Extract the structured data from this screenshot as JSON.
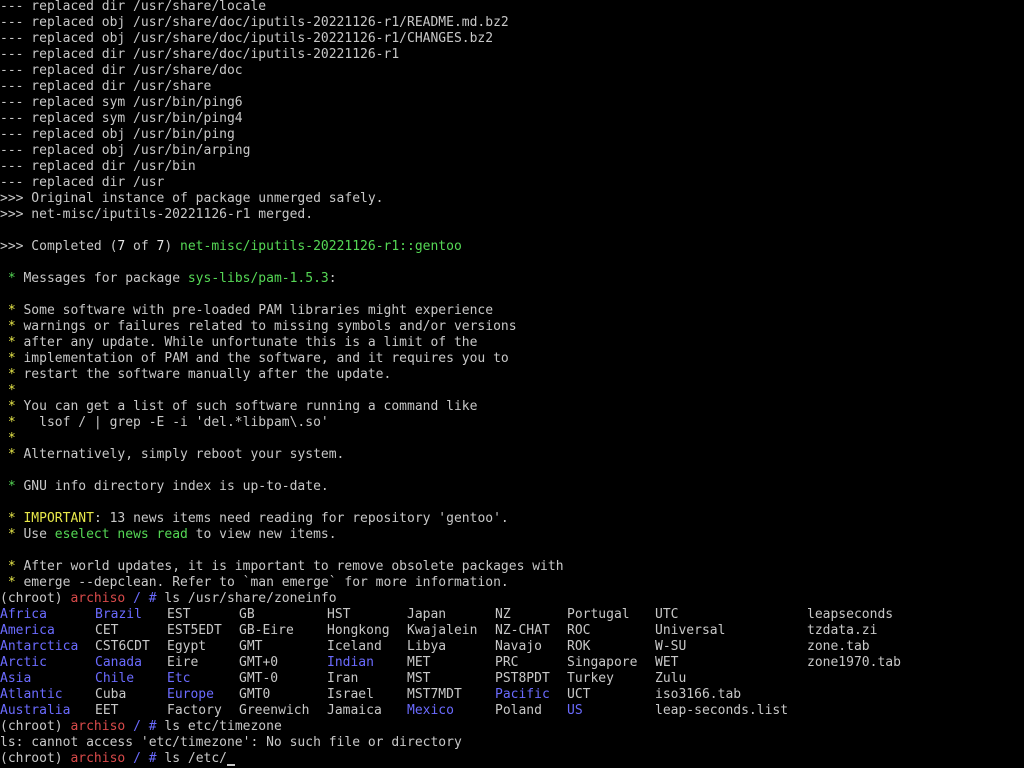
{
  "theme": {
    "background": "#000000",
    "default": "#c8c8c8",
    "green": "#55d855",
    "yellow": "#e8e84a",
    "blue": "#6b6bff",
    "red": "#d84a4a"
  },
  "lines_before": [
    [
      {
        "t": "--- replaced dir /usr/share/locale",
        "c": "default"
      }
    ],
    [
      {
        "t": "--- replaced obj /usr/share/doc/iputils-20221126-r1/README.md.bz2",
        "c": "default"
      }
    ],
    [
      {
        "t": "--- replaced obj /usr/share/doc/iputils-20221126-r1/CHANGES.bz2",
        "c": "default"
      }
    ],
    [
      {
        "t": "--- replaced dir /usr/share/doc/iputils-20221126-r1",
        "c": "default"
      }
    ],
    [
      {
        "t": "--- replaced dir /usr/share/doc",
        "c": "default"
      }
    ],
    [
      {
        "t": "--- replaced dir /usr/share",
        "c": "default"
      }
    ],
    [
      {
        "t": "--- replaced sym /usr/bin/ping6",
        "c": "default"
      }
    ],
    [
      {
        "t": "--- replaced sym /usr/bin/ping4",
        "c": "default"
      }
    ],
    [
      {
        "t": "--- replaced obj /usr/bin/ping",
        "c": "default"
      }
    ],
    [
      {
        "t": "--- replaced obj /usr/bin/arping",
        "c": "default"
      }
    ],
    [
      {
        "t": "--- replaced dir /usr/bin",
        "c": "default"
      }
    ],
    [
      {
        "t": "--- replaced dir /usr",
        "c": "default"
      }
    ],
    [
      {
        "t": ">>> Original instance of package unmerged safely.",
        "c": "default"
      }
    ],
    [
      {
        "t": ">>> net-misc/iputils-20221126-r1 merged.",
        "c": "default"
      }
    ],
    [],
    [
      {
        "t": ">>> Completed (",
        "c": "default"
      },
      {
        "t": "7",
        "c": "bold"
      },
      {
        "t": " of ",
        "c": "default"
      },
      {
        "t": "7",
        "c": "bold"
      },
      {
        "t": ") ",
        "c": "default"
      },
      {
        "t": "net-misc/iputils-20221126-r1::gentoo",
        "c": "green"
      }
    ],
    [],
    [
      {
        "t": " * ",
        "c": "green"
      },
      {
        "t": "Messages for package ",
        "c": "default"
      },
      {
        "t": "sys-libs/pam-1.5.3",
        "c": "green"
      },
      {
        "t": ":",
        "c": "default"
      }
    ],
    [],
    [
      {
        "t": " * ",
        "c": "yellow"
      },
      {
        "t": "Some software with pre-loaded PAM libraries might experience",
        "c": "default"
      }
    ],
    [
      {
        "t": " * ",
        "c": "yellow"
      },
      {
        "t": "warnings or failures related to missing symbols and/or versions",
        "c": "default"
      }
    ],
    [
      {
        "t": " * ",
        "c": "yellow"
      },
      {
        "t": "after any update. While unfortunate this is a limit of the",
        "c": "default"
      }
    ],
    [
      {
        "t": " * ",
        "c": "yellow"
      },
      {
        "t": "implementation of PAM and the software, and it requires you to",
        "c": "default"
      }
    ],
    [
      {
        "t": " * ",
        "c": "yellow"
      },
      {
        "t": "restart the software manually after the update.",
        "c": "default"
      }
    ],
    [
      {
        "t": " * ",
        "c": "yellow"
      }
    ],
    [
      {
        "t": " * ",
        "c": "yellow"
      },
      {
        "t": "You can get a list of such software running a command like",
        "c": "default"
      }
    ],
    [
      {
        "t": " * ",
        "c": "yellow"
      },
      {
        "t": "  lsof / | grep -E -i 'del.*libpam\\.so'",
        "c": "default"
      }
    ],
    [
      {
        "t": " * ",
        "c": "yellow"
      }
    ],
    [
      {
        "t": " * ",
        "c": "yellow"
      },
      {
        "t": "Alternatively, simply reboot your system.",
        "c": "default"
      }
    ],
    [],
    [
      {
        "t": " * ",
        "c": "green"
      },
      {
        "t": "GNU info directory index is up-to-date.",
        "c": "default"
      }
    ],
    [],
    [
      {
        "t": " * ",
        "c": "yellow"
      },
      {
        "t": "IMPORTANT",
        "c": "yellow"
      },
      {
        "t": ": 13 news items need reading for repository 'gentoo'.",
        "c": "default"
      }
    ],
    [
      {
        "t": " * ",
        "c": "yellow"
      },
      {
        "t": "Use ",
        "c": "default"
      },
      {
        "t": "eselect news read",
        "c": "green"
      },
      {
        "t": " to view new items.",
        "c": "default"
      }
    ],
    [],
    [
      {
        "t": " * ",
        "c": "yellow"
      },
      {
        "t": "After world updates, it is important to remove obsolete packages with",
        "c": "default"
      }
    ],
    [
      {
        "t": " * ",
        "c": "yellow"
      },
      {
        "t": "emerge --depclean. Refer to `man emerge` for more information.",
        "c": "default"
      }
    ],
    [
      {
        "t": "(chroot) ",
        "c": "default"
      },
      {
        "t": "archiso",
        "c": "red"
      },
      {
        "t": " / # ",
        "c": "blue"
      },
      {
        "t": "ls /usr/share/zoneinfo",
        "c": "default"
      }
    ]
  ],
  "zoneinfo_columns": [
    [
      {
        "t": "Africa",
        "c": "blue"
      },
      {
        "t": "America",
        "c": "blue"
      },
      {
        "t": "Antarctica",
        "c": "blue"
      },
      {
        "t": "Arctic",
        "c": "blue"
      },
      {
        "t": "Asia",
        "c": "blue"
      },
      {
        "t": "Atlantic",
        "c": "blue"
      },
      {
        "t": "Australia",
        "c": "blue"
      }
    ],
    [
      {
        "t": "Brazil",
        "c": "blue"
      },
      {
        "t": "CET",
        "c": "default"
      },
      {
        "t": "CST6CDT",
        "c": "default"
      },
      {
        "t": "Canada",
        "c": "blue"
      },
      {
        "t": "Chile",
        "c": "blue"
      },
      {
        "t": "Cuba",
        "c": "default"
      },
      {
        "t": "EET",
        "c": "default"
      }
    ],
    [
      {
        "t": "EST",
        "c": "default"
      },
      {
        "t": "EST5EDT",
        "c": "default"
      },
      {
        "t": "Egypt",
        "c": "default"
      },
      {
        "t": "Eire",
        "c": "default"
      },
      {
        "t": "Etc",
        "c": "blue"
      },
      {
        "t": "Europe",
        "c": "blue"
      },
      {
        "t": "Factory",
        "c": "default"
      }
    ],
    [
      {
        "t": "GB",
        "c": "default"
      },
      {
        "t": "GB-Eire",
        "c": "default"
      },
      {
        "t": "GMT",
        "c": "default"
      },
      {
        "t": "GMT+0",
        "c": "default"
      },
      {
        "t": "GMT-0",
        "c": "default"
      },
      {
        "t": "GMT0",
        "c": "default"
      },
      {
        "t": "Greenwich",
        "c": "default"
      }
    ],
    [
      {
        "t": "HST",
        "c": "default"
      },
      {
        "t": "Hongkong",
        "c": "default"
      },
      {
        "t": "Iceland",
        "c": "default"
      },
      {
        "t": "Indian",
        "c": "blue"
      },
      {
        "t": "Iran",
        "c": "default"
      },
      {
        "t": "Israel",
        "c": "default"
      },
      {
        "t": "Jamaica",
        "c": "default"
      }
    ],
    [
      {
        "t": "Japan",
        "c": "default"
      },
      {
        "t": "Kwajalein",
        "c": "default"
      },
      {
        "t": "Libya",
        "c": "default"
      },
      {
        "t": "MET",
        "c": "default"
      },
      {
        "t": "MST",
        "c": "default"
      },
      {
        "t": "MST7MDT",
        "c": "default"
      },
      {
        "t": "Mexico",
        "c": "blue"
      }
    ],
    [
      {
        "t": "NZ",
        "c": "default"
      },
      {
        "t": "NZ-CHAT",
        "c": "default"
      },
      {
        "t": "Navajo",
        "c": "default"
      },
      {
        "t": "PRC",
        "c": "default"
      },
      {
        "t": "PST8PDT",
        "c": "default"
      },
      {
        "t": "Pacific",
        "c": "blue"
      },
      {
        "t": "Poland",
        "c": "default"
      }
    ],
    [
      {
        "t": "Portugal",
        "c": "default"
      },
      {
        "t": "ROC",
        "c": "default"
      },
      {
        "t": "ROK",
        "c": "default"
      },
      {
        "t": "Singapore",
        "c": "default"
      },
      {
        "t": "Turkey",
        "c": "default"
      },
      {
        "t": "UCT",
        "c": "default"
      },
      {
        "t": "US",
        "c": "blue"
      }
    ],
    [
      {
        "t": "UTC",
        "c": "default"
      },
      {
        "t": "Universal",
        "c": "default"
      },
      {
        "t": "W-SU",
        "c": "default"
      },
      {
        "t": "WET",
        "c": "default"
      },
      {
        "t": "Zulu",
        "c": "default"
      },
      {
        "t": "iso3166.tab",
        "c": "default"
      },
      {
        "t": "leap-seconds.list",
        "c": "default"
      }
    ],
    [
      {
        "t": "leapseconds",
        "c": "default"
      },
      {
        "t": "tzdata.zi",
        "c": "default"
      },
      {
        "t": "zone.tab",
        "c": "default"
      },
      {
        "t": "zone1970.tab",
        "c": "default"
      }
    ]
  ],
  "lines_after": [
    [
      {
        "t": "(chroot) ",
        "c": "default"
      },
      {
        "t": "archiso",
        "c": "red"
      },
      {
        "t": " / # ",
        "c": "blue"
      },
      {
        "t": "ls etc/timezone",
        "c": "default"
      }
    ],
    [
      {
        "t": "ls: cannot access 'etc/timezone': No such file or directory",
        "c": "default"
      }
    ]
  ],
  "prompt": {
    "prefix": "(chroot) ",
    "host": "archiso",
    "path": " / # ",
    "input": "ls /etc/"
  }
}
